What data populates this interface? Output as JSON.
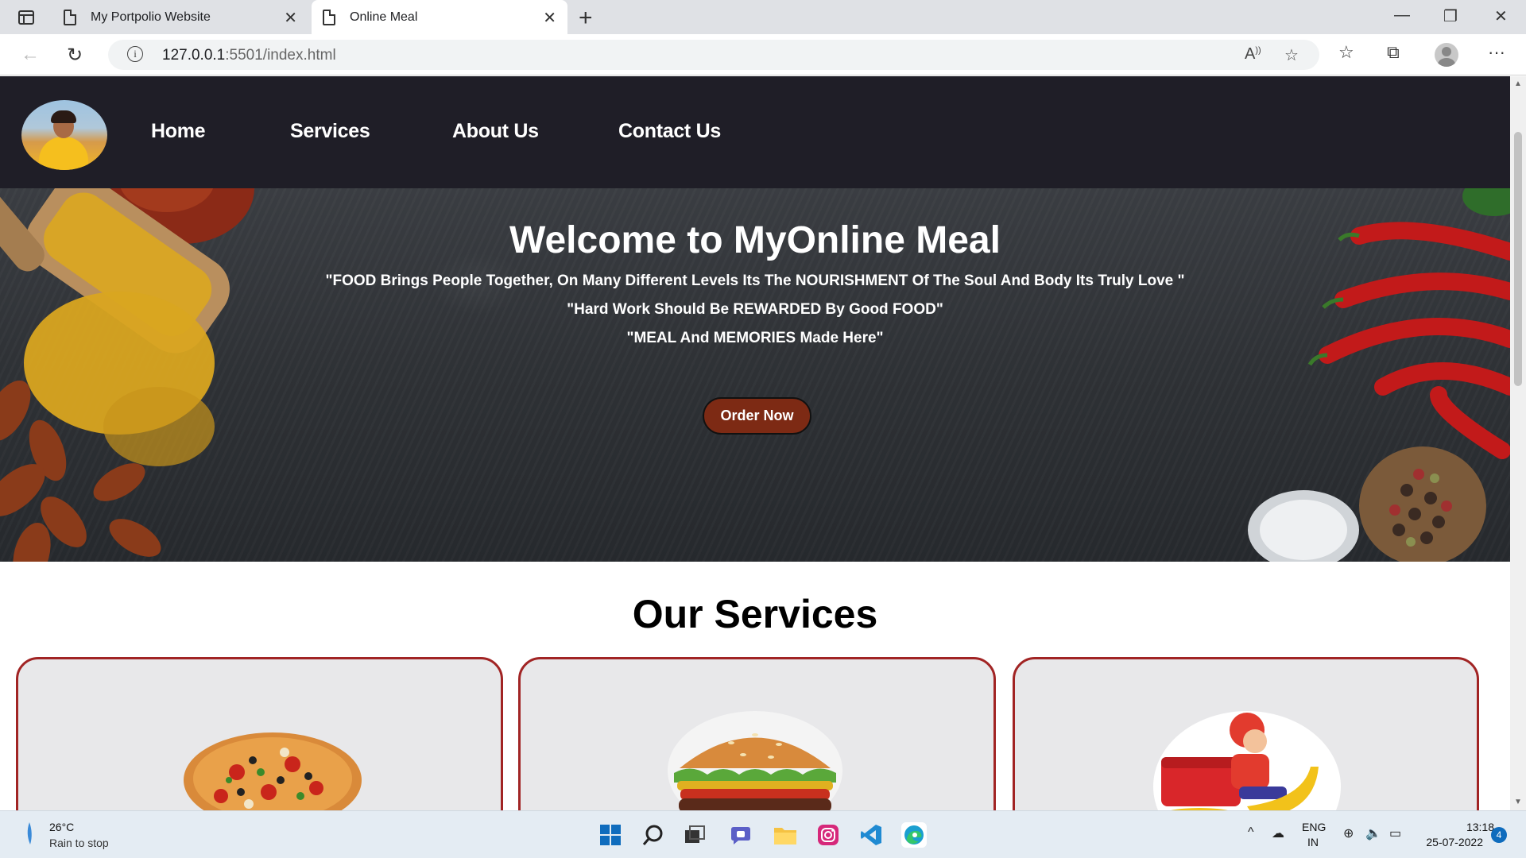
{
  "browser": {
    "tabs": [
      {
        "title": "My Portpolio Website",
        "active": false
      },
      {
        "title": "Online Meal",
        "active": true
      }
    ],
    "url_host": "127.0.0.1",
    "url_rest": ":5501/index.html"
  },
  "site": {
    "nav": [
      "Home",
      "Services",
      "About Us",
      "Contact Us"
    ],
    "hero": {
      "title": "Welcome to MyOnline Meal",
      "quotes": [
        "\"FOOD Brings People Together, On Many Different Levels Its The NOURISHMENT Of The Soul And Body Its Truly Love \"",
        "\"Hard Work Should Be REWARDED By Good FOOD\"",
        "\"MEAL And MEMORIES Made Here\""
      ],
      "cta": "Order Now"
    },
    "services_title": "Our Services",
    "service_images": [
      "pizza",
      "burger",
      "delivery-scooter"
    ]
  },
  "taskbar": {
    "temperature": "26°C",
    "weather": "Rain to stop",
    "lang1": "ENG",
    "lang2": "IN",
    "time": "13:18",
    "date": "25-07-2022",
    "notifications": "4"
  },
  "colors": {
    "nav_bg": "#1f1e27",
    "card_border": "#a12424",
    "order_btn": "#7d2a14"
  }
}
